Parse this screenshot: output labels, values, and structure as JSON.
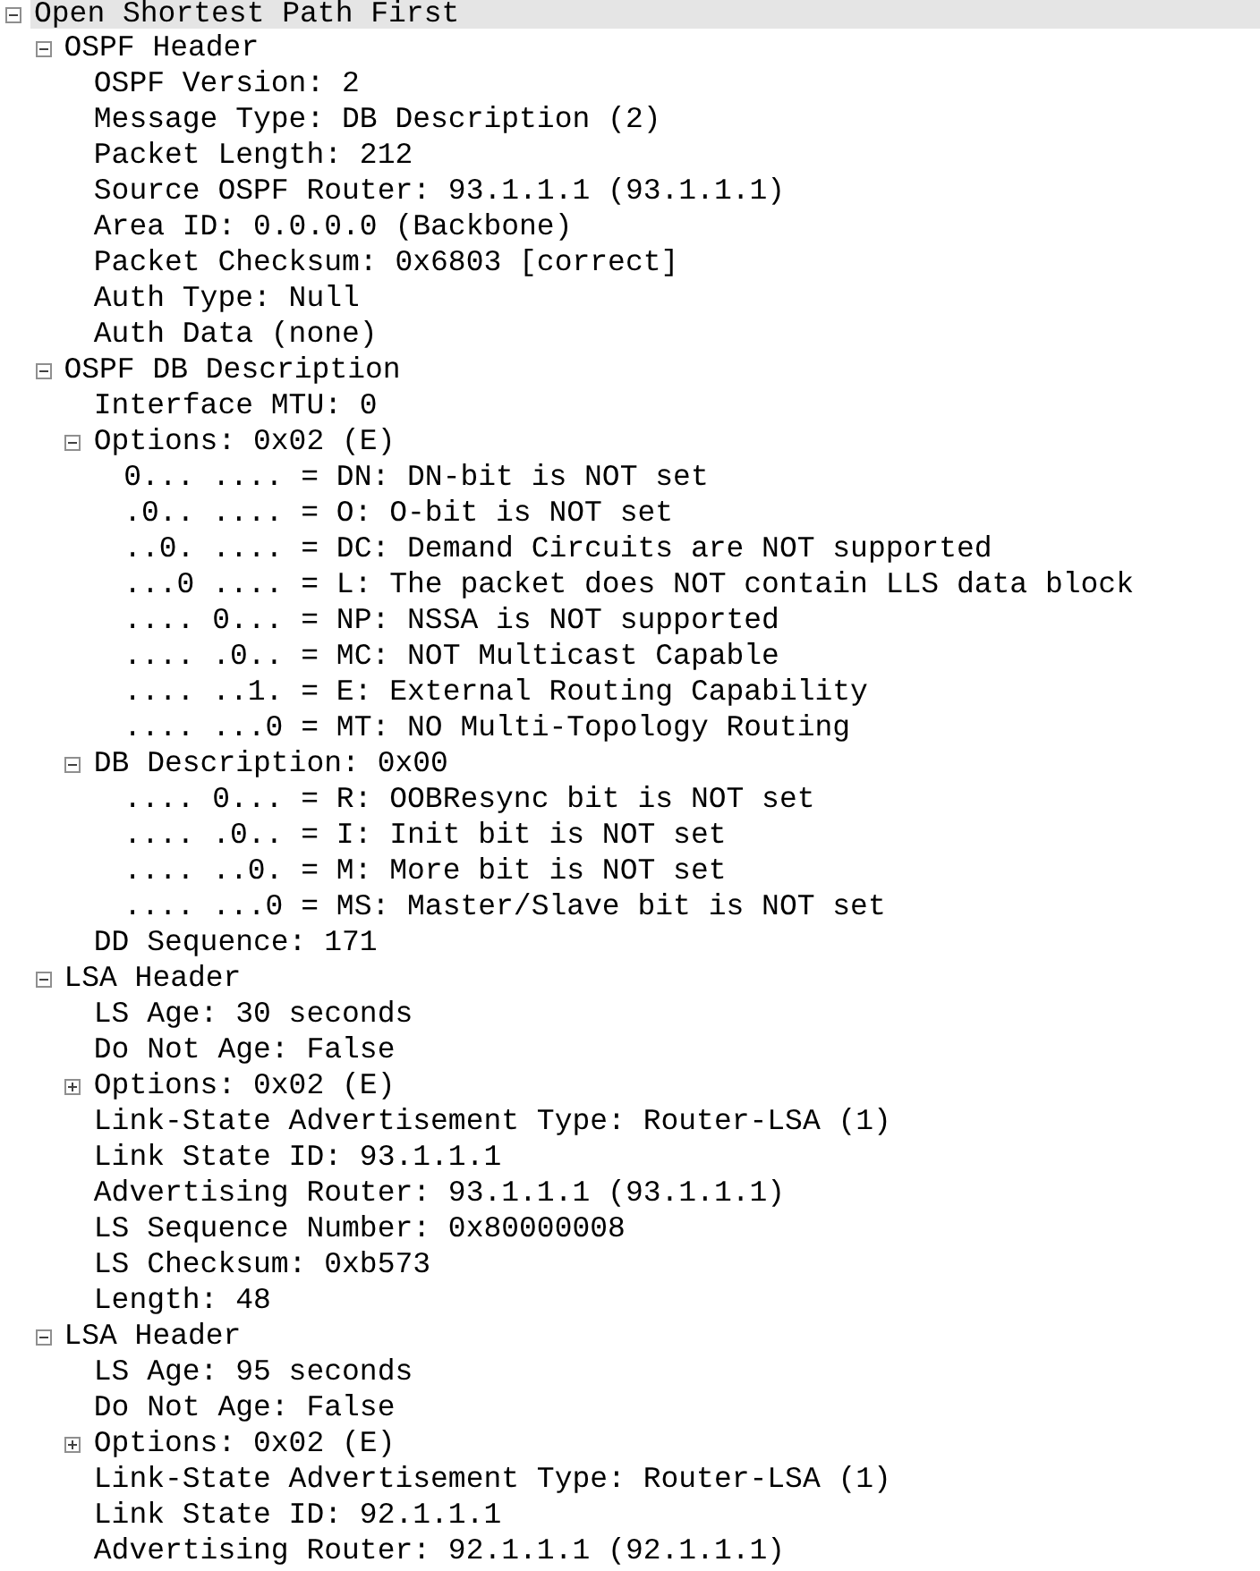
{
  "tree": [
    {
      "label": "Open Shortest Path First",
      "selected": true,
      "expanded": true,
      "children": [
        {
          "label": "OSPF Header",
          "selected": false,
          "expanded": true,
          "children": [
            {
              "label": "OSPF Version: 2",
              "selected": false
            },
            {
              "label": "Message Type: DB Description (2)",
              "selected": false
            },
            {
              "label": "Packet Length: 212",
              "selected": false
            },
            {
              "label": "Source OSPF Router: 93.1.1.1 (93.1.1.1)",
              "selected": false
            },
            {
              "label": "Area ID: 0.0.0.0 (Backbone)",
              "selected": false
            },
            {
              "label": "Packet Checksum: 0x6803 [correct]",
              "selected": false
            },
            {
              "label": "Auth Type: Null",
              "selected": false
            },
            {
              "label": "Auth Data (none)",
              "selected": false
            }
          ]
        },
        {
          "label": "OSPF DB Description",
          "selected": false,
          "expanded": true,
          "children": [
            {
              "label": "Interface MTU: 0",
              "selected": false
            },
            {
              "label": "Options: 0x02 (E)",
              "selected": false,
              "expanded": true,
              "children": [
                {
                  "label": "0... .... = DN: DN-bit is NOT set",
                  "selected": false
                },
                {
                  "label": ".0.. .... = O: O-bit is NOT set",
                  "selected": false
                },
                {
                  "label": "..0. .... = DC: Demand Circuits are NOT supported",
                  "selected": false
                },
                {
                  "label": "...0 .... = L: The packet does NOT contain LLS data block",
                  "selected": false
                },
                {
                  "label": ".... 0... = NP: NSSA is NOT supported",
                  "selected": false
                },
                {
                  "label": ".... .0.. = MC: NOT Multicast Capable",
                  "selected": false
                },
                {
                  "label": ".... ..1. = E: External Routing Capability",
                  "selected": false
                },
                {
                  "label": ".... ...0 = MT: NO Multi-Topology Routing",
                  "selected": false
                }
              ]
            },
            {
              "label": "DB Description: 0x00",
              "selected": false,
              "expanded": true,
              "children": [
                {
                  "label": ".... 0... = R: OOBResync bit is NOT set",
                  "selected": false
                },
                {
                  "label": ".... .0.. = I: Init bit is NOT set",
                  "selected": false
                },
                {
                  "label": ".... ..0. = M: More bit is NOT set",
                  "selected": false
                },
                {
                  "label": ".... ...0 = MS: Master/Slave bit is NOT set",
                  "selected": false
                }
              ]
            },
            {
              "label": "DD Sequence: 171",
              "selected": false
            }
          ]
        },
        {
          "label": "LSA Header",
          "selected": false,
          "expanded": true,
          "children": [
            {
              "label": "LS Age: 30 seconds",
              "selected": false
            },
            {
              "label": "Do Not Age: False",
              "selected": false
            },
            {
              "label": "Options: 0x02 (E)",
              "selected": false,
              "expanded": false
            },
            {
              "label": "Link-State Advertisement Type: Router-LSA (1)",
              "selected": false
            },
            {
              "label": "Link State ID: 93.1.1.1",
              "selected": false
            },
            {
              "label": "Advertising Router: 93.1.1.1 (93.1.1.1)",
              "selected": false
            },
            {
              "label": "LS Sequence Number: 0x80000008",
              "selected": false
            },
            {
              "label": "LS Checksum: 0xb573",
              "selected": false
            },
            {
              "label": "Length: 48",
              "selected": false
            }
          ]
        },
        {
          "label": "LSA Header",
          "selected": false,
          "expanded": true,
          "children": [
            {
              "label": "LS Age: 95 seconds",
              "selected": false
            },
            {
              "label": "Do Not Age: False",
              "selected": false
            },
            {
              "label": "Options: 0x02 (E)",
              "selected": false,
              "expanded": false
            },
            {
              "label": "Link-State Advertisement Type: Router-LSA (1)",
              "selected": false
            },
            {
              "label": "Link State ID: 92.1.1.1",
              "selected": false
            },
            {
              "label": "Advertising Router: 92.1.1.1 (92.1.1.1)",
              "selected": false
            }
          ]
        }
      ]
    }
  ]
}
